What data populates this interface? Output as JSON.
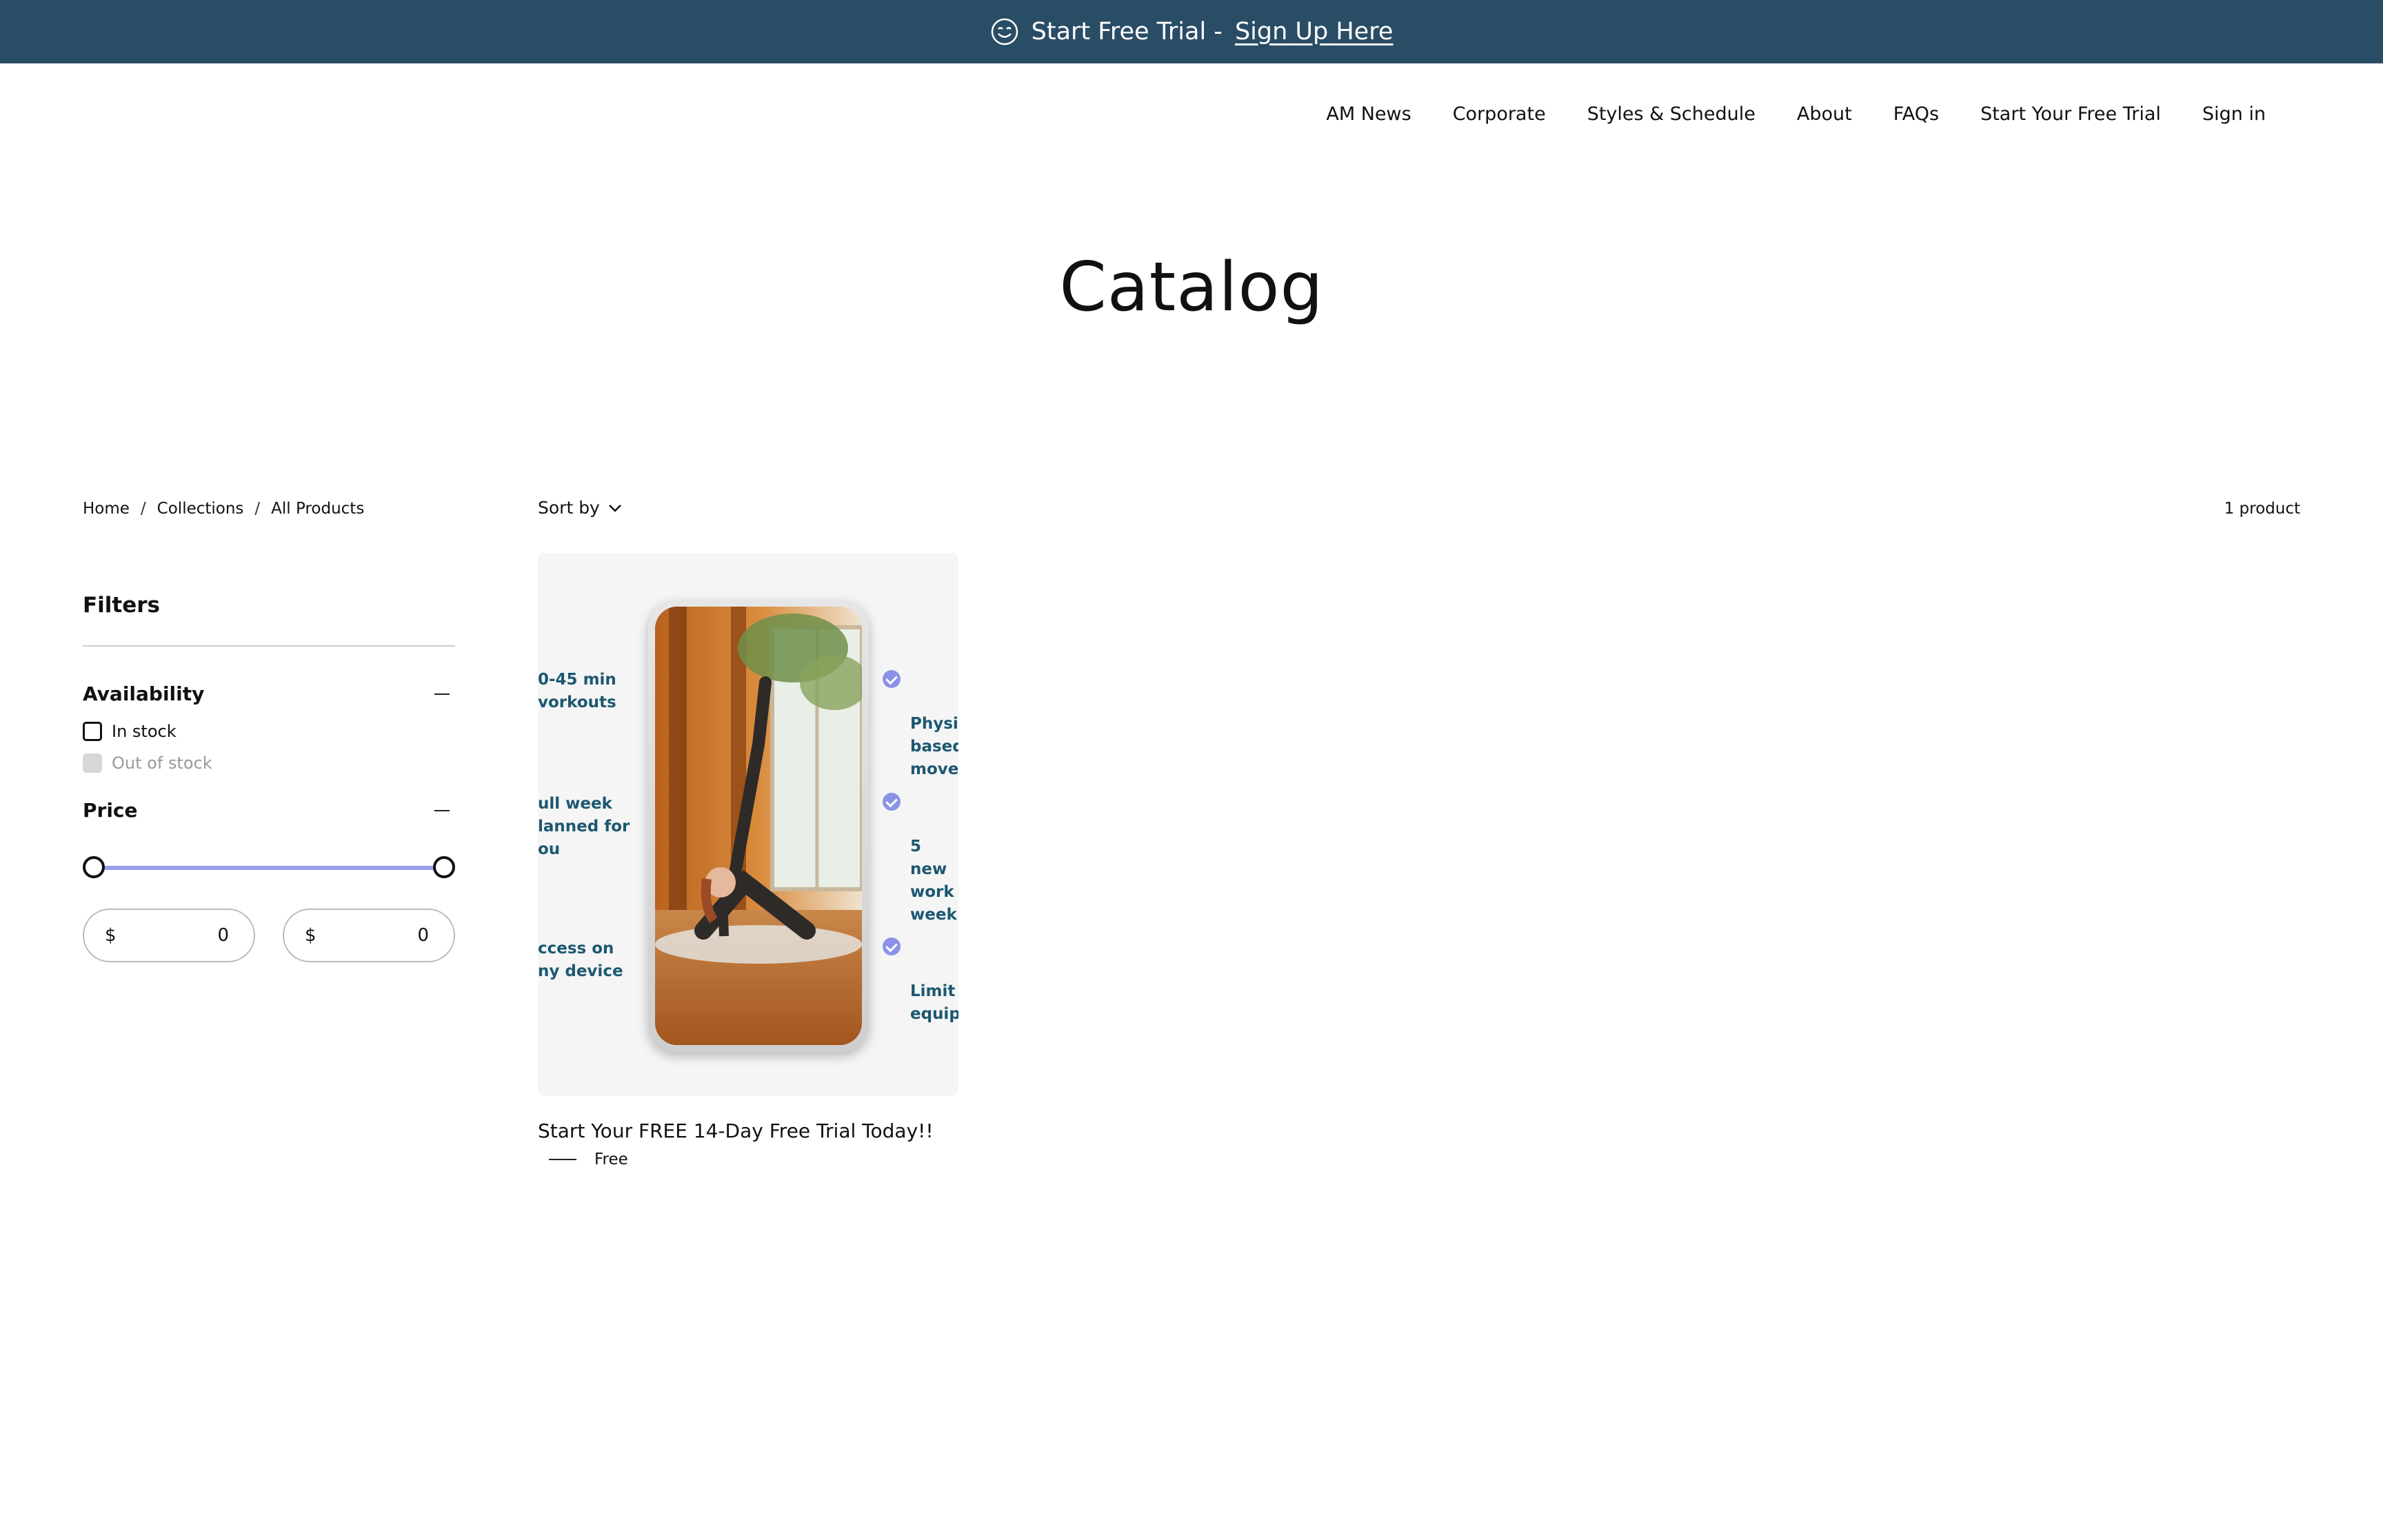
{
  "announcement": {
    "text": "Start Free Trial - ",
    "link": "Sign Up Here"
  },
  "nav": {
    "items": [
      "AM News",
      "Corporate",
      "Styles & Schedule",
      "About",
      "FAQs",
      "Start Your Free Trial",
      "Sign in"
    ]
  },
  "page": {
    "title": "Catalog"
  },
  "breadcrumb": {
    "items": [
      "Home",
      "Collections",
      "All Products"
    ],
    "separator": "/"
  },
  "toolbar": {
    "sort_label": "Sort by",
    "count": "1 product"
  },
  "filters": {
    "title": "Filters",
    "availability": {
      "title": "Availability",
      "options": [
        {
          "label": "In stock",
          "disabled": false
        },
        {
          "label": "Out of stock",
          "disabled": true
        }
      ]
    },
    "price": {
      "title": "Price",
      "currency": "$",
      "min_value": "0",
      "max_value": "0"
    }
  },
  "product": {
    "title": "Start Your FREE 14-Day Free Trial Today!!",
    "price": "Free",
    "image_text": {
      "left": [
        "0-45 min\nvorkouts",
        "ull week\nlanned for\nou",
        "ccess on\nny device"
      ],
      "right": [
        "Physi\nbased\nmove",
        "5 new\nwork\nweek",
        "Limit\nequip"
      ]
    }
  },
  "colors": {
    "announcement_bg": "#2a4d66",
    "slider_track": "#9aa0ec",
    "feature_text": "#1c5870"
  }
}
